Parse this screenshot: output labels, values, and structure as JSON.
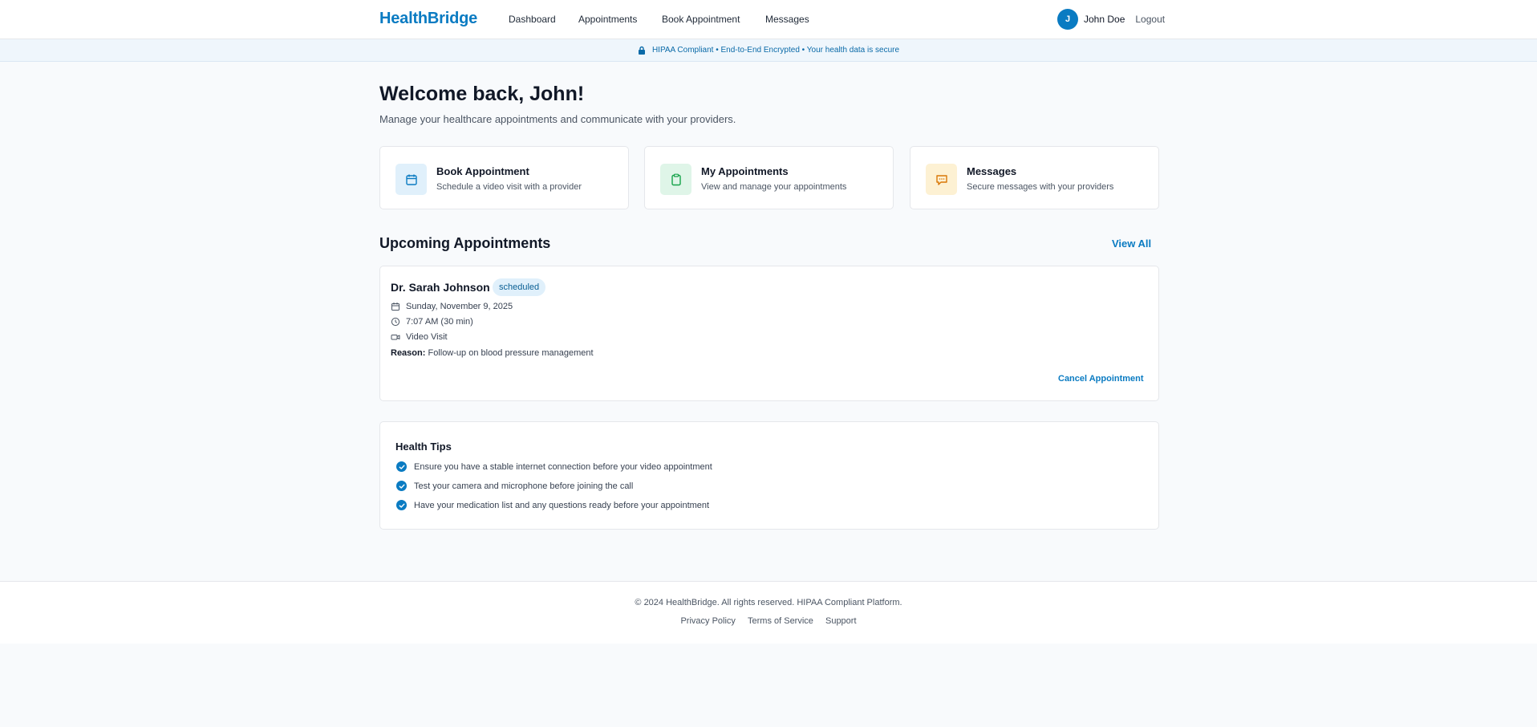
{
  "header": {
    "brand": "HealthBridge",
    "nav": [
      "Dashboard",
      "Appointments",
      "Book Appointment",
      "Messages"
    ],
    "user": {
      "initial": "J",
      "name": "John Doe"
    },
    "logout": "Logout"
  },
  "banner": {
    "text": "HIPAA Compliant • End-to-End Encrypted • Your health data is secure"
  },
  "welcome": {
    "title": "Welcome back, John!",
    "subtitle": "Manage your healthcare appointments and communicate with your providers."
  },
  "quick_actions": [
    {
      "title": "Book Appointment",
      "description": "Schedule a video visit with a provider",
      "icon": "calendar-icon"
    },
    {
      "title": "My Appointments",
      "description": "View and manage your appointments",
      "icon": "clipboard-icon"
    },
    {
      "title": "Messages",
      "description": "Secure messages with your providers",
      "icon": "chat-icon"
    }
  ],
  "upcoming": {
    "title": "Upcoming Appointments",
    "view_all": "View All",
    "appointments": [
      {
        "doctor": "Dr. Sarah Johnson",
        "status": "scheduled",
        "date": "Sunday, November 9, 2025",
        "time": "7:07 AM (30 min)",
        "type": "Video Visit",
        "reason_label": "Reason:",
        "reason": "Follow-up on blood pressure management",
        "cancel": "Cancel Appointment"
      }
    ]
  },
  "tips": {
    "title": "Health Tips",
    "items": [
      "Ensure you have a stable internet connection before your video appointment",
      "Test your camera and microphone before joining the call",
      "Have your medication list and any questions ready before your appointment"
    ]
  },
  "footer": {
    "copyright": "© 2024 HealthBridge. All rights reserved. HIPAA Compliant Platform.",
    "links": [
      "Privacy Policy",
      "Terms of Service",
      "Support"
    ]
  },
  "colors": {
    "brand": "#0a7bc2",
    "background": "#f8fafc",
    "banner_bg": "#eff6fc"
  }
}
